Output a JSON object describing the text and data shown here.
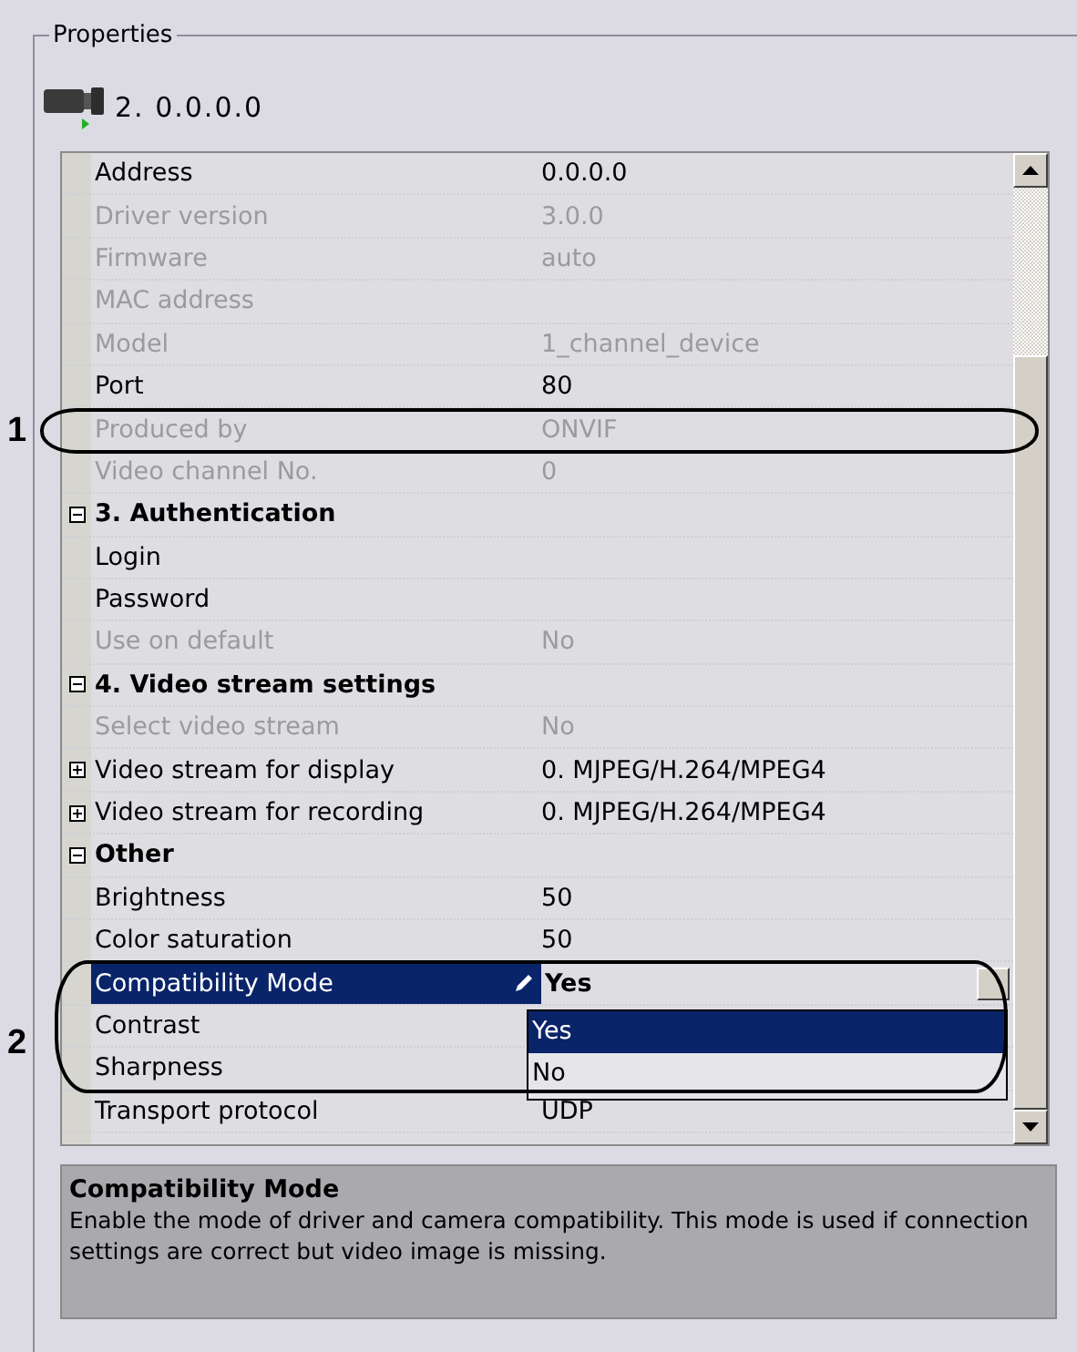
{
  "panel": {
    "title": "Properties"
  },
  "device": {
    "name": "2. 0.0.0.0"
  },
  "grid": {
    "rows": [
      {
        "kind": "property",
        "label": "Address",
        "value": "0.0.0.0",
        "disabled": false,
        "selected": false
      },
      {
        "kind": "property",
        "label": "Driver version",
        "value": "3.0.0",
        "disabled": true,
        "selected": false
      },
      {
        "kind": "property",
        "label": "Firmware",
        "value": "auto",
        "disabled": true,
        "selected": false
      },
      {
        "kind": "property",
        "label": "MAC address",
        "disabled": true,
        "selected": false
      },
      {
        "kind": "property",
        "label": "Model",
        "value": "1_channel_device",
        "disabled": true,
        "selected": false
      },
      {
        "kind": "property",
        "label": "Port",
        "value": "80",
        "disabled": false,
        "selected": false
      },
      {
        "kind": "property",
        "label": "Produced by",
        "value": "ONVIF",
        "disabled": true,
        "selected": false
      },
      {
        "kind": "property",
        "label": "Video channel No.",
        "value": "0",
        "disabled": true,
        "selected": false
      },
      {
        "kind": "category",
        "label": "3. Authentication",
        "expanded": true
      },
      {
        "kind": "property",
        "label": "Login",
        "disabled": false,
        "selected": false
      },
      {
        "kind": "property",
        "label": "Password",
        "disabled": false,
        "selected": false
      },
      {
        "kind": "property",
        "label": "Use on default",
        "value": "No",
        "disabled": true,
        "selected": false
      },
      {
        "kind": "category",
        "label": "4. Video stream settings",
        "expanded": true
      },
      {
        "kind": "property",
        "label": "Select video stream",
        "value": "No",
        "disabled": true,
        "selected": false
      },
      {
        "kind": "property",
        "label": "Video stream for display",
        "value": "0. MJPEG/H.264/MPEG4",
        "disabled": false,
        "selected": false,
        "expanded": false
      },
      {
        "kind": "property",
        "label": "Video stream for recording",
        "value": "0. MJPEG/H.264/MPEG4",
        "disabled": false,
        "selected": false,
        "expanded": false
      },
      {
        "kind": "category",
        "label": "Other",
        "expanded": true
      },
      {
        "kind": "property",
        "label": "Brightness",
        "value": "50",
        "disabled": false,
        "selected": false
      },
      {
        "kind": "property",
        "label": "Color saturation",
        "value": "50",
        "disabled": false,
        "selected": false
      },
      {
        "kind": "property",
        "label": "Compatibility Mode",
        "value": "Yes",
        "disabled": false,
        "selected": true,
        "options": [
          {
            "label": "Yes",
            "selected": true
          },
          {
            "label": "No",
            "selected": false
          }
        ]
      },
      {
        "kind": "property",
        "label": "Contrast",
        "disabled": false,
        "selected": false
      },
      {
        "kind": "property",
        "label": "Sharpness",
        "disabled": false,
        "selected": false
      },
      {
        "kind": "property",
        "label": "Transport protocol",
        "value": "UDP",
        "disabled": false,
        "selected": false
      }
    ]
  },
  "description": {
    "title": "Compatibility Mode",
    "text": "Enable the mode of driver and camera compatibility. This mode is used if connection settings are correct but video image is missing."
  },
  "annotations": [
    {
      "label": "1"
    },
    {
      "label": "2"
    }
  ]
}
